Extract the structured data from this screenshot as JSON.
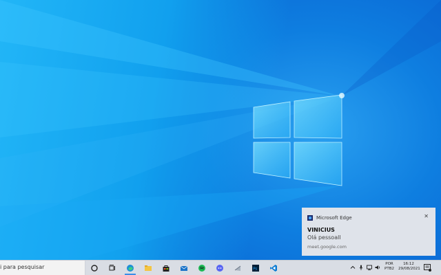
{
  "toast": {
    "app_name": "Microsoft Edge",
    "close_icon": "close-icon",
    "title": "VINICIUS",
    "message": "Olá pessoall",
    "source": "meet.google.com"
  },
  "taskbar": {
    "search_placeholder": "i para pesquisar",
    "apps": [
      {
        "name": "cortana",
        "icon": "cortana-ring-icon"
      },
      {
        "name": "task-view",
        "icon": "task-view-icon"
      },
      {
        "name": "edge",
        "icon": "edge-icon"
      },
      {
        "name": "file-explorer",
        "icon": "folder-icon"
      },
      {
        "name": "store",
        "icon": "store-bag-icon"
      },
      {
        "name": "mail",
        "icon": "mail-icon"
      },
      {
        "name": "spotify",
        "icon": "spotify-icon"
      },
      {
        "name": "discord",
        "icon": "discord-icon"
      },
      {
        "name": "app-gray",
        "icon": "app-icon"
      },
      {
        "name": "photoshop",
        "icon": "photoshop-icon"
      },
      {
        "name": "vscode",
        "icon": "vscode-icon"
      }
    ],
    "tray": {
      "lang_line1": "POR",
      "lang_line2": "PTB2",
      "time": "16:12",
      "date": "29/08/2021"
    }
  },
  "colors": {
    "desktop_blue": "#0a63d2",
    "accent": "#3b8ee8"
  }
}
